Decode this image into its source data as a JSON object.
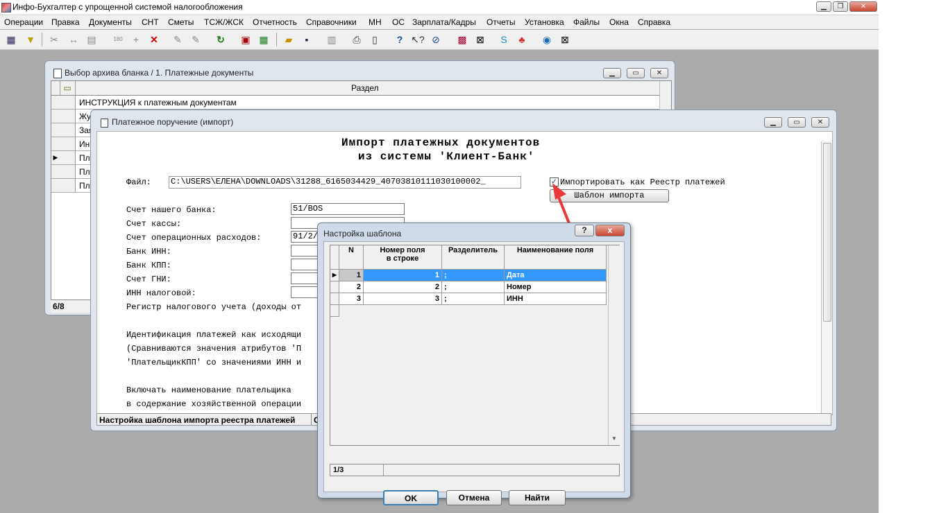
{
  "app": {
    "title": "Инфо-Бухгалтер с упрощенной системой налогообложения",
    "menu": [
      "Операции",
      "Правка",
      "Документы",
      "СНТ",
      "Сметы",
      "ТСЖ/ЖСК",
      "Отчетность",
      "Справочники",
      "МН",
      "ОС",
      "Зарплата/Кадры",
      "Отчеты",
      "Установка",
      "Файлы",
      "Окна",
      "Справка"
    ]
  },
  "archive_window": {
    "title": "Выбор архива бланка /    1. Платежные документы",
    "column_header": "Раздел",
    "rows": [
      "ИНСТРУКЦИЯ к платежным документам",
      "Жур",
      "Зая",
      "Инк",
      "Пла",
      "Пла",
      "Пла"
    ],
    "status": "6/8"
  },
  "import_window": {
    "title": "Платежное поручение (импорт)",
    "heading_line1": "Импорт платежных документов",
    "heading_line2": "из системы 'Клиент-Банк'",
    "file_label": "Файл:",
    "file_value": "C:\\USERS\\ЕЛЕНА\\DOWNLOADS\\31288_6165034429_40703810111030100002_",
    "import_as_registry_label": "Импортировать как Реестр платежей",
    "import_as_registry_checked": true,
    "template_button": "Шаблон импорта",
    "fields": [
      {
        "label": "Счет нашего банка:",
        "value": "51/BOS"
      },
      {
        "label": "Счет кассы:",
        "value": ""
      },
      {
        "label": "Счет операционных расходов:",
        "value": "91/2/"
      },
      {
        "label": "Банк ИНН:",
        "value": ""
      },
      {
        "label": "Банк КПП:",
        "value": ""
      },
      {
        "label": "Счет ГНИ:",
        "value": ""
      },
      {
        "label": "ИНН налоговой:",
        "value": ""
      }
    ],
    "text_lines": [
      "Регистр налогового учета (доходы от",
      "Идентификация платежей как исходящи",
      "(Сравниваются значения атрибутов 'П",
      "'ПлательщикКПП' со значениями ИНН и",
      "Включать наименование плательщика",
      "в содержание хозяйственной операции"
    ],
    "status_left": "Настройка шаблона импорта реестра платежей",
    "status_right": "С"
  },
  "template_dialog": {
    "title": "Настройка шаблона",
    "help_button": "?",
    "close_button": "x",
    "columns": [
      "N",
      "Номер поля\nв строке",
      "Разделитель",
      "Наименование поля"
    ],
    "rows": [
      {
        "n": "1",
        "field_no": "1",
        "separator": ";",
        "name": "Дата",
        "selected": true
      },
      {
        "n": "2",
        "field_no": "2",
        "separator": ";",
        "name": "Номер",
        "selected": false
      },
      {
        "n": "3",
        "field_no": "3",
        "separator": ";",
        "name": "ИНН",
        "selected": false
      }
    ],
    "status": "1/3",
    "ok_button": "OK",
    "cancel_button": "Отмена",
    "find_button": "Найти"
  },
  "colors": {
    "selection": "#3399ff",
    "arrow": "#e83a3a",
    "desktop": "#ababab"
  }
}
